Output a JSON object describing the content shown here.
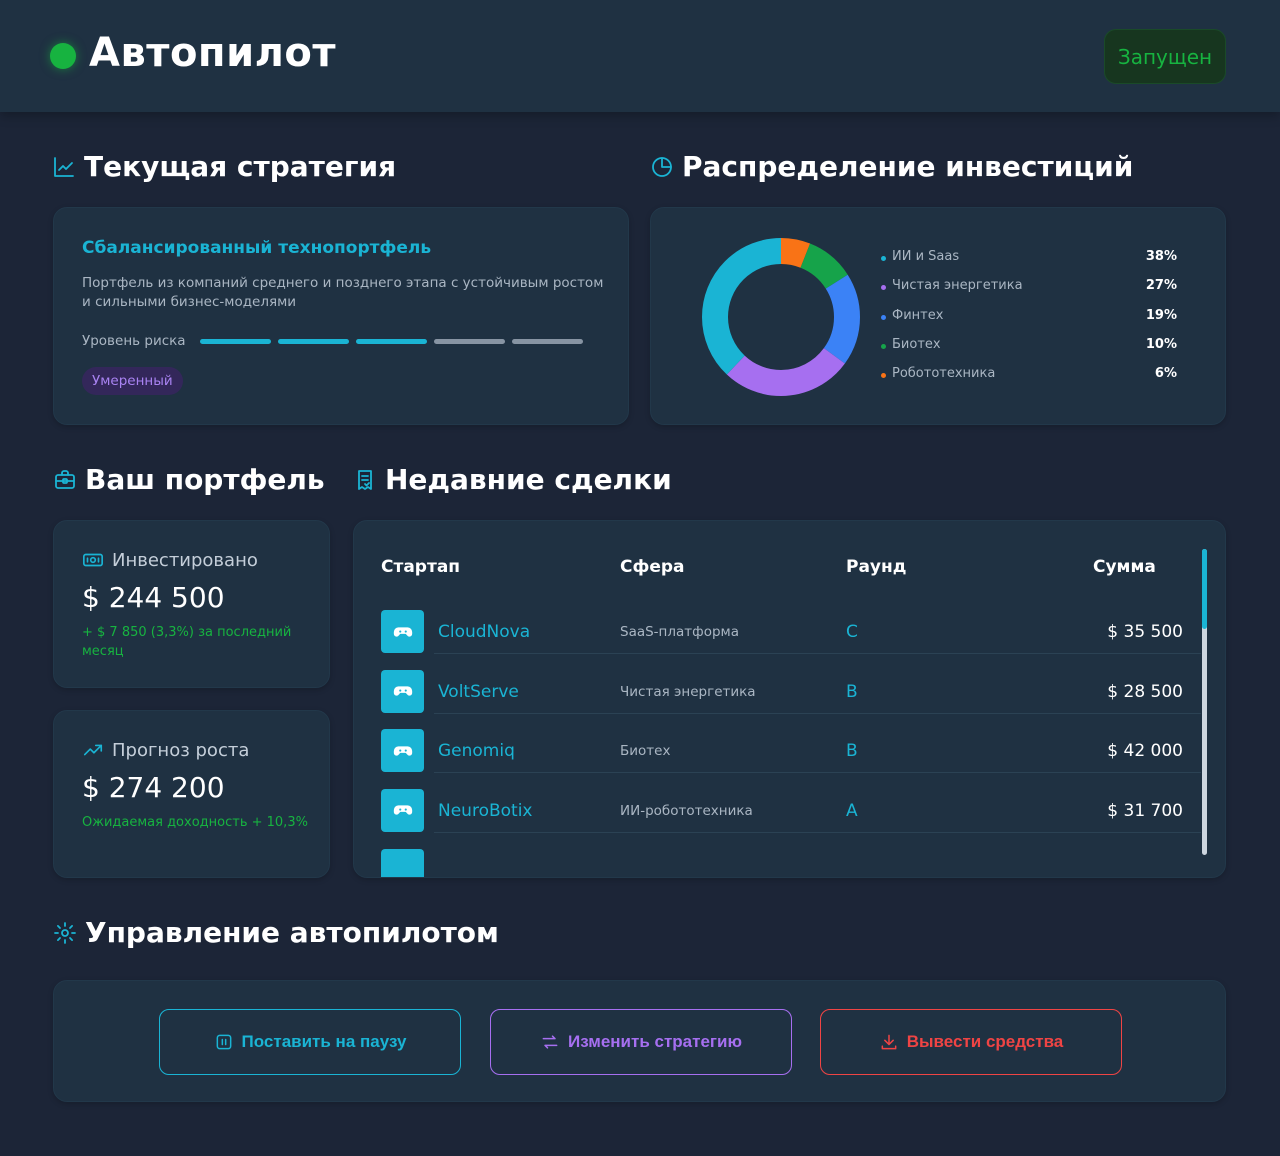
{
  "header": {
    "title": "Автопилот",
    "status": "Запущен"
  },
  "strategy": {
    "section_title": "Текущая стратегия",
    "name": "Сбалансированный технопортфель",
    "description": "Портфель из компаний среднего и позднего этапа с устойчивым ростом и сильными бизнес-моделями",
    "risk_label": "Уровень риска",
    "risk_level": 3,
    "risk_max": 5,
    "risk_badge": "Умеренный"
  },
  "allocation": {
    "section_title": "Распределение инвестиций",
    "items": [
      {
        "name": "ИИ и Saas",
        "value": "38%",
        "pct": 38,
        "color": "#1ab4d4"
      },
      {
        "name": "Чистая энергетика",
        "value": "27%",
        "pct": 27,
        "color": "#a66ff0"
      },
      {
        "name": "Финтех",
        "value": "19%",
        "pct": 19,
        "color": "#3b82f6"
      },
      {
        "name": "Биотех",
        "value": "10%",
        "pct": 10,
        "color": "#16a34a"
      },
      {
        "name": "Робототехника",
        "value": "6%",
        "pct": 6,
        "color": "#f97316"
      }
    ]
  },
  "portfolio": {
    "section_title": "Ваш портфель",
    "invested_label": "Инвестировано",
    "invested_value": "$ 244 500",
    "invested_note": "+ $ 7 850 (3,3%) за последний месяц",
    "growth_label": "Прогноз роста",
    "growth_value": "$ 274 200",
    "growth_note": "Ожидаемая доходность + 10,3%"
  },
  "deals": {
    "section_title": "Недавние сделки",
    "columns": {
      "startup": "Стартап",
      "sector": "Сфера",
      "round": "Раунд",
      "amount": "Сумма"
    },
    "rows": [
      {
        "name": "CloudNova",
        "sector": "SaaS-платформа",
        "round": "C",
        "amount": "$ 35 500"
      },
      {
        "name": "VoltServe",
        "sector": "Чистая энергетика",
        "round": "B",
        "amount": "$ 28 500"
      },
      {
        "name": "Genomiq",
        "sector": "Биотех",
        "round": "B",
        "amount": "$ 42 000"
      },
      {
        "name": "NeuroBotix",
        "sector": "ИИ-робототехника",
        "round": "A",
        "amount": "$ 31 700"
      }
    ]
  },
  "controls": {
    "section_title": "Управление автопилотом",
    "pause": "Поставить на паузу",
    "change": "Изменить стратегию",
    "withdraw": "Вывести средства"
  },
  "colors": {
    "accent": "#1ab4d4",
    "success": "#17b340",
    "purple": "#a66ff0",
    "danger": "#ef4444",
    "inactive": "#8794a3"
  }
}
